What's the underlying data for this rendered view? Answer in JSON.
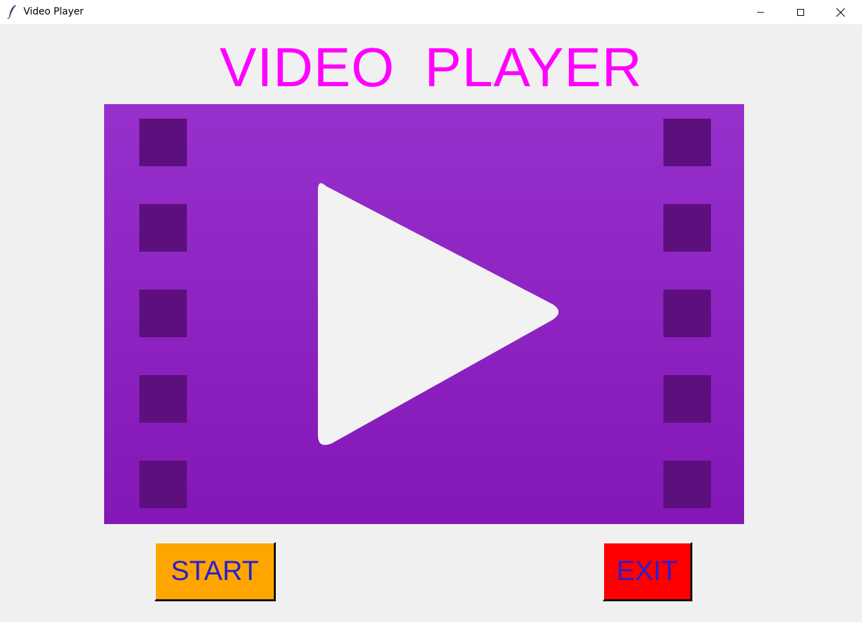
{
  "window": {
    "title": "Video Player",
    "controls": {
      "minimize_icon": "minimize-icon",
      "maximize_icon": "maximize-icon",
      "close_icon": "close-icon"
    }
  },
  "main": {
    "heading": "VIDEO  PLAYER",
    "poster_icon": "film-play-icon"
  },
  "buttons": {
    "start_label": "START",
    "exit_label": "EXIT"
  },
  "colors": {
    "heading": "#ff00ff",
    "poster_top": "#9730cc",
    "poster_bottom": "#8417b7",
    "perforation": "#5d107d",
    "play_triangle": "#f2f2f2",
    "start_bg": "#ffa500",
    "exit_bg": "#ff0000",
    "button_text": "#2a1fcf",
    "window_bg": "#f0f0f0"
  }
}
